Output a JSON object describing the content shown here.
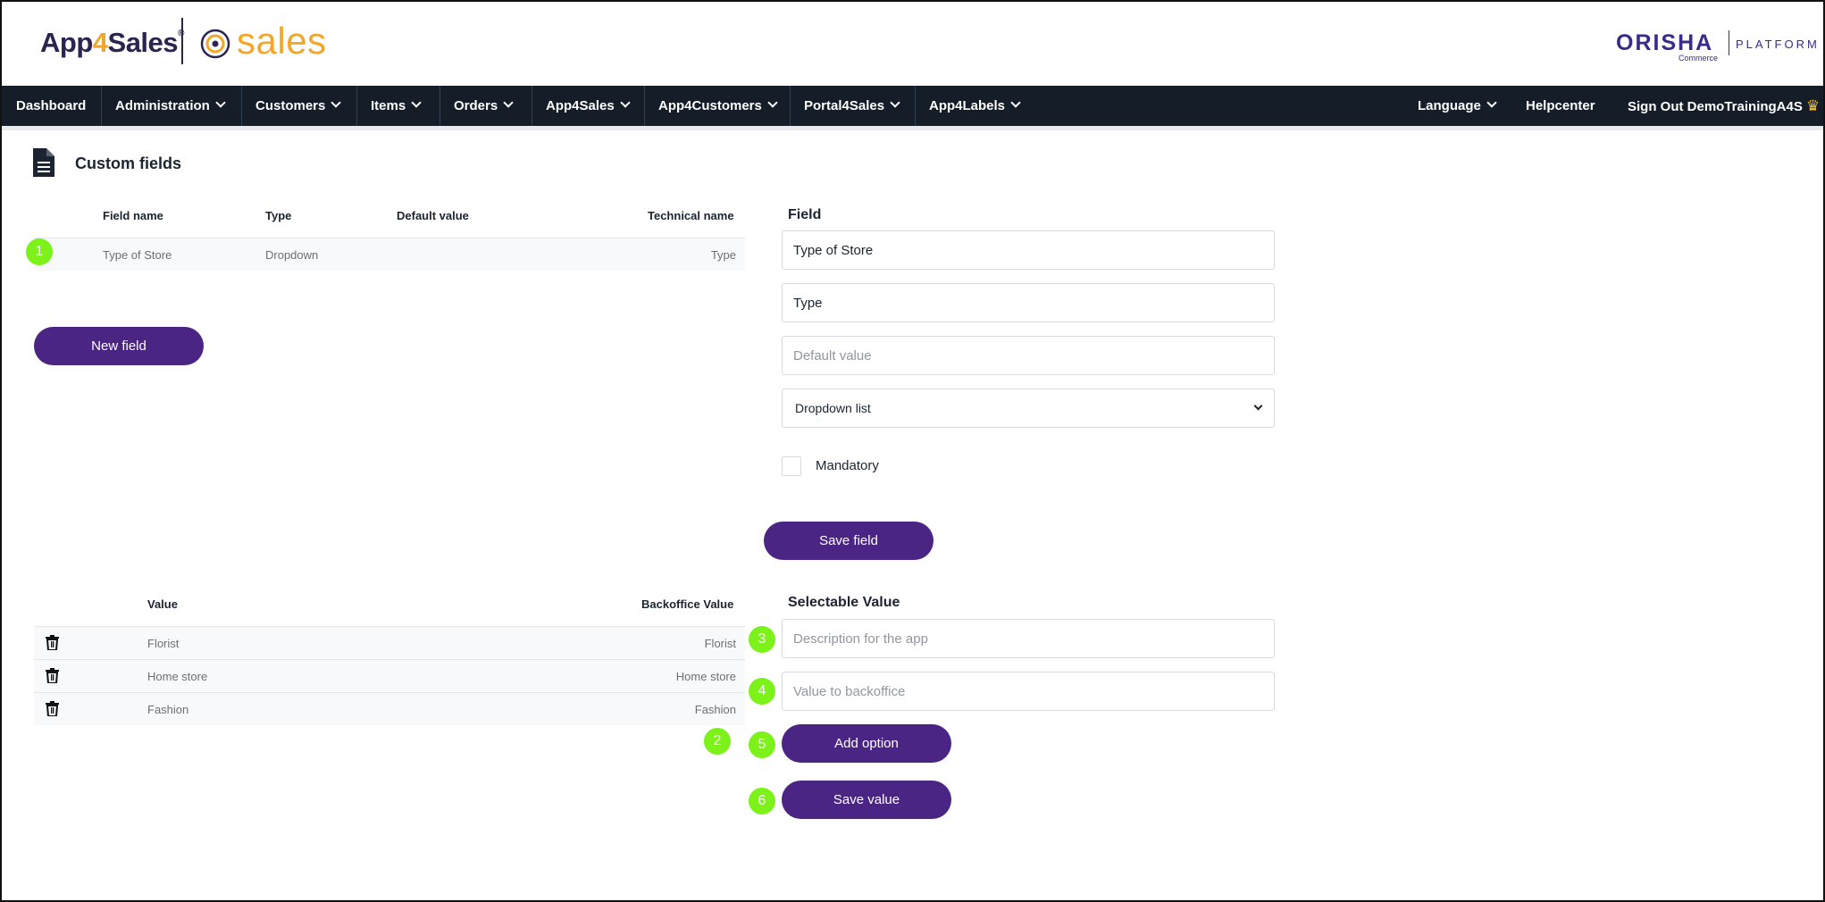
{
  "header": {
    "brand_app": "App",
    "brand_four": "4",
    "brand_sales": "Sales",
    "brand_reg": "®",
    "sales_word": "sales",
    "orisha_name": "ORISHA",
    "orisha_sub": "Commerce",
    "orisha_platform": "PLATFORM"
  },
  "nav": {
    "items": [
      {
        "label": "Dashboard"
      },
      {
        "label": "Administration"
      },
      {
        "label": "Customers"
      },
      {
        "label": "Items"
      },
      {
        "label": "Orders"
      },
      {
        "label": "App4Sales"
      },
      {
        "label": "App4Customers"
      },
      {
        "label": "Portal4Sales"
      },
      {
        "label": "App4Labels"
      }
    ],
    "right": {
      "language": "Language",
      "helpcenter": "Helpcenter",
      "signout_prefix": "Sign Out ",
      "username": "DemoTrainingA4S",
      "crown": "♛"
    }
  },
  "page": {
    "title": "Custom fields"
  },
  "fields_table": {
    "headers": [
      "Field name",
      "Type",
      "Default value",
      "Technical name"
    ],
    "rows": [
      {
        "name": "Type of Store",
        "type": "Dropdown",
        "default": "",
        "technical": "Type"
      }
    ],
    "new_field_label": "New field"
  },
  "field_form": {
    "heading": "Field",
    "name_value": "Type of Store",
    "technical_value": "Type",
    "default_placeholder": "Default value",
    "type_selected": "Dropdown list",
    "mandatory_label": "Mandatory",
    "save_label": "Save field"
  },
  "values_table": {
    "headers": [
      "Value",
      "Backoffice Value"
    ],
    "rows": [
      {
        "value": "Florist",
        "backoffice": "Florist"
      },
      {
        "value": "Home store",
        "backoffice": "Home store"
      },
      {
        "value": "Fashion",
        "backoffice": "Fashion"
      }
    ]
  },
  "value_form": {
    "heading": "Selectable Value",
    "description_placeholder": "Description for the app",
    "backoffice_placeholder": "Value to backoffice",
    "add_label": "Add option",
    "save_label": "Save value"
  },
  "badges": [
    "1",
    "2",
    "3",
    "4",
    "5",
    "6"
  ],
  "colors": {
    "nav_bg": "#141d28",
    "button": "#4a2583",
    "badge": "#7cf21a",
    "brand_orange": "#f2a72b",
    "brand_navy": "#2b2350"
  }
}
